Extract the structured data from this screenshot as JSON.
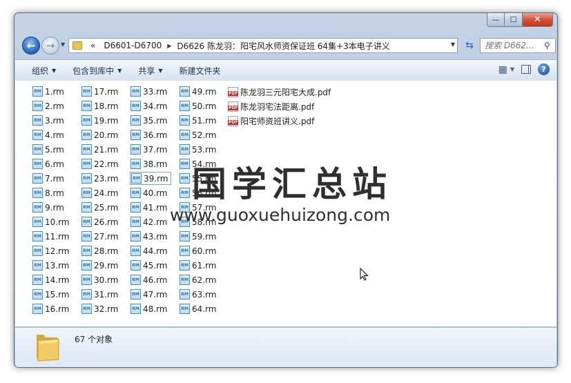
{
  "window": {
    "caption": {
      "min": "—",
      "max": "☐",
      "close": "✕"
    }
  },
  "address": {
    "overflow": "«",
    "segments": [
      "D6601-D6700",
      "D6626 陈龙羽：阳宅风水师资保证班 64集+3本电子讲义"
    ],
    "search_placeholder": "搜索 D662..."
  },
  "toolbar": {
    "items": [
      "组织",
      "包含到库中",
      "共享",
      "新建文件夹"
    ]
  },
  "files": {
    "rm": [
      "1.rm",
      "2.rm",
      "3.rm",
      "4.rm",
      "5.rm",
      "6.rm",
      "7.rm",
      "8.rm",
      "9.rm",
      "10.rm",
      "11.rm",
      "12.rm",
      "13.rm",
      "14.rm",
      "15.rm",
      "16.rm",
      "17.rm",
      "18.rm",
      "19.rm",
      "20.rm",
      "21.rm",
      "22.rm",
      "23.rm",
      "24.rm",
      "25.rm",
      "26.rm",
      "27.rm",
      "28.rm",
      "29.rm",
      "30.rm",
      "31.rm",
      "32.rm",
      "33.rm",
      "34.rm",
      "35.rm",
      "36.rm",
      "37.rm",
      "38.rm",
      "39.rm",
      "40.rm",
      "41.rm",
      "42.rm",
      "43.rm",
      "44.rm",
      "45.rm",
      "46.rm",
      "47.rm",
      "48.rm",
      "49.rm",
      "50.rm",
      "51.rm",
      "52.rm",
      "53.rm",
      "54.rm",
      "55.rm",
      "56.rm",
      "57.rm",
      "58.rm",
      "59.rm",
      "60.rm",
      "61.rm",
      "62.rm",
      "63.rm",
      "64.rm"
    ],
    "selected": "39.rm",
    "rm_icon_label": "RM",
    "pdf": [
      "陈龙羽三元阳宅大成.pdf",
      "陈龙羽宅法距离.pdf",
      "阳宅师资班讲义.pdf"
    ],
    "pdf_icon_label": "PDF"
  },
  "watermark": {
    "text": "国学汇总站",
    "url": "www.guoxuehuizong.com"
  },
  "details": {
    "count": "67 个对象"
  },
  "icons": {
    "back": "←",
    "forward": "→",
    "refresh": "⇆",
    "search": "⚲",
    "views": "▦",
    "help": "?"
  },
  "colors": {
    "frame": "#b5c7de",
    "selection_border": "#7da2ce",
    "close_red": "#d5513a"
  }
}
